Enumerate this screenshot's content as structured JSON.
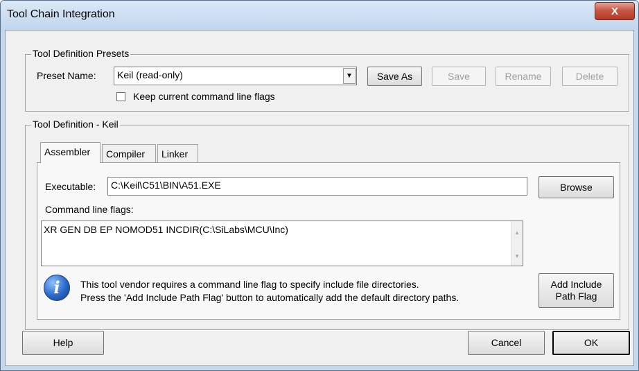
{
  "window": {
    "title": "Tool Chain Integration",
    "close_glyph": "X"
  },
  "presets": {
    "legend": "Tool Definition Presets",
    "preset_label": "Preset Name:",
    "preset_value": "Keil (read-only)",
    "buttons": {
      "save_as": "Save As",
      "save": "Save",
      "rename": "Rename",
      "delete": "Delete"
    },
    "keep_flags_label": "Keep current command line flags",
    "keep_flags_checked": false
  },
  "definition": {
    "legend": "Tool Definition - Keil",
    "tabs": [
      {
        "label": "Assembler",
        "active": true
      },
      {
        "label": "Compiler",
        "active": false
      },
      {
        "label": "Linker",
        "active": false
      }
    ],
    "executable_label": "Executable:",
    "executable_value": "C:\\Keil\\C51\\BIN\\A51.EXE",
    "browse_label": "Browse",
    "flags_label": "Command line flags:",
    "flags_value": "XR GEN DB EP NOMOD51 INCDIR(C:\\SiLabs\\MCU\\Inc)",
    "info_line1": "This tool vendor requires a command line flag to specify include file directories.",
    "info_line2": "Press the 'Add Include Path Flag' button to automatically add the default directory paths.",
    "add_include_label": "Add Include Path Flag"
  },
  "footer": {
    "help": "Help",
    "cancel": "Cancel",
    "ok": "OK"
  }
}
